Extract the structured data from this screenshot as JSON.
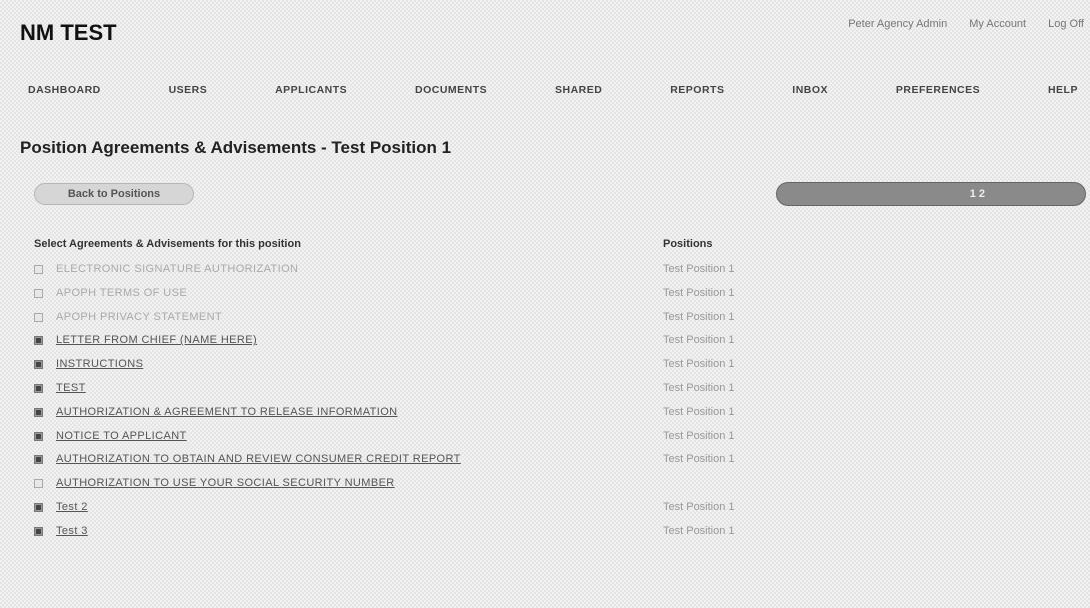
{
  "app": {
    "title": "NM TEST"
  },
  "topbar": {
    "user": "Peter Agency Admin",
    "account": "My Account",
    "logout": "Log Off"
  },
  "nav": [
    "DASHBOARD",
    "USERS",
    "APPLICANTS",
    "DOCUMENTS",
    "SHARED",
    "REPORTS",
    "INBOX",
    "PREFERENCES",
    "HELP"
  ],
  "page": {
    "title": "Position Agreements & Advisements - Test Position 1"
  },
  "actions": {
    "back": "Back to Positions",
    "pager": "1 2"
  },
  "table": {
    "col_agreements": "Select Agreements & Advisements for this position",
    "col_positions": "Positions",
    "rows": [
      {
        "label": "ELECTRONIC SIGNATURE AUTHORIZATION",
        "position": "Test Position 1",
        "checked": false
      },
      {
        "label": "APOPH TERMS OF USE",
        "position": "Test Position 1",
        "checked": false
      },
      {
        "label": "APOPH PRIVACY STATEMENT",
        "position": "Test Position 1",
        "checked": false
      },
      {
        "label": "LETTER FROM CHIEF (NAME HERE)",
        "position": "Test Position 1",
        "checked": true
      },
      {
        "label": "INSTRUCTIONS",
        "position": "Test Position 1",
        "checked": true
      },
      {
        "label": "TEST",
        "position": "Test Position 1",
        "checked": true
      },
      {
        "label": "AUTHORIZATION & AGREEMENT TO RELEASE INFORMATION",
        "position": "Test Position 1",
        "checked": true
      },
      {
        "label": "NOTICE TO APPLICANT",
        "position": "Test Position 1",
        "checked": true
      },
      {
        "label": "AUTHORIZATION TO OBTAIN AND REVIEW CONSUMER CREDIT REPORT",
        "position": "Test Position 1",
        "checked": true
      },
      {
        "label": "AUTHORIZATION TO USE YOUR SOCIAL SECURITY NUMBER",
        "position": "",
        "checked": false
      },
      {
        "label": "Test 2",
        "position": "Test Position 1",
        "checked": true
      },
      {
        "label": "Test 3",
        "position": "Test Position 1",
        "checked": true
      }
    ]
  }
}
